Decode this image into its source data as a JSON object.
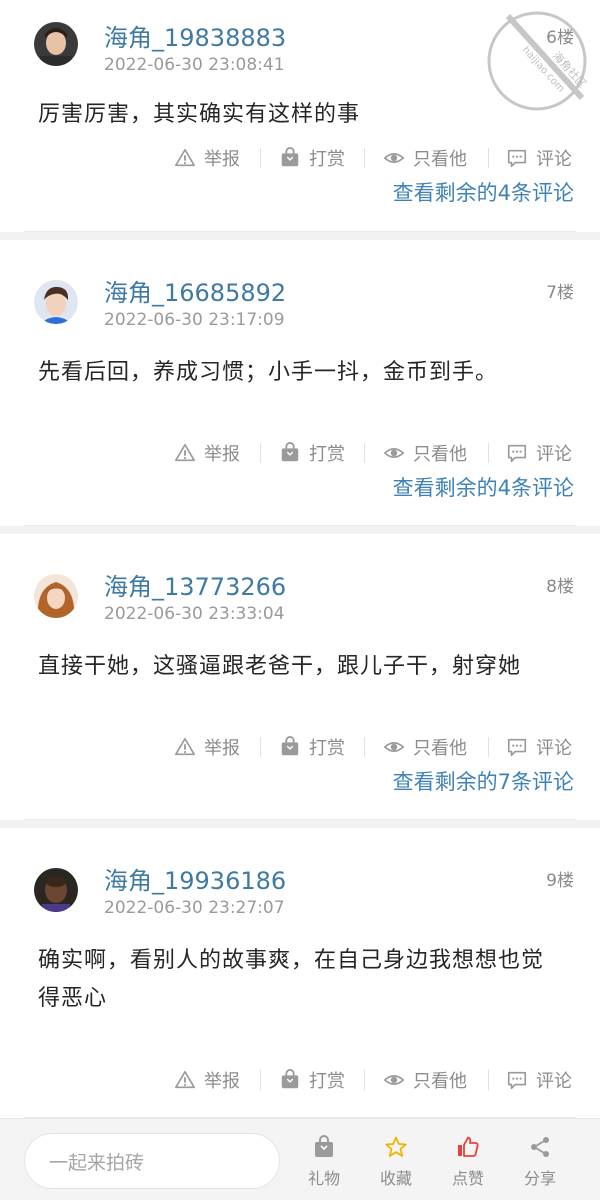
{
  "posts": [
    {
      "username": "海角_19838883",
      "timestamp": "2022-06-30 23:08:41",
      "floor": "6楼",
      "content": "厉害厉害，其实确实有这样的事",
      "more_comments": "查看剩余的4条评论"
    },
    {
      "username": "海角_16685892",
      "timestamp": "2022-06-30 23:17:09",
      "floor": "7楼",
      "content": "先看后回，养成习惯；小手一抖，金币到手。",
      "more_comments": "查看剩余的4条评论"
    },
    {
      "username": "海角_13773266",
      "timestamp": "2022-06-30 23:33:04",
      "floor": "8楼",
      "content": "直接干她，这骚逼跟老爸干，跟儿子干，射穿她",
      "more_comments": "查看剩余的7条评论"
    },
    {
      "username": "海角_19936186",
      "timestamp": "2022-06-30 23:27:07",
      "floor": "9楼",
      "content": "确实啊，看别人的故事爽，在自己身边我想想也觉得恶心",
      "more_comments": ""
    }
  ],
  "actions": {
    "report": "举报",
    "tip": "打赏",
    "only_him": "只看他",
    "comment": "评论"
  },
  "watermark": {
    "name": "海角社区",
    "url": "haijiao.com"
  },
  "bottom_bar": {
    "input_placeholder": "一起来拍砖",
    "gift": "礼物",
    "favorite": "收藏",
    "like": "点赞",
    "share": "分享"
  },
  "colors": {
    "username": "#3f7aa3",
    "link": "#3f82b8",
    "favorite_icon": "#f0b400",
    "like_icon": "#e8413c"
  },
  "icons": {
    "report": "warning-triangle-icon",
    "tip": "bag-icon",
    "only_him": "eye-icon",
    "comment": "comment-bubble-icon",
    "gift": "gift-bag-icon",
    "favorite": "star-icon",
    "like": "thumbs-up-icon",
    "share": "share-icon"
  }
}
